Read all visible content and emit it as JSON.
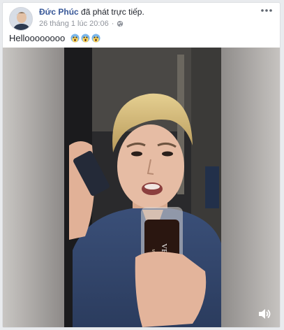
{
  "post": {
    "author": "Đức Phúc",
    "action": "đã phát trực tiếp.",
    "timestamp": "26 tháng 1 lúc 20:06",
    "privacy_icon": "globe-icon",
    "menu_icon": "more-options-icon",
    "caption": "Helloooooooo",
    "caption_emojis": [
      "scream-emoji",
      "scream-emoji",
      "scream-emoji"
    ]
  },
  "video": {
    "volume_icon": "volume-icon",
    "cup_text": "VEAIET",
    "cup_subtext": "MERIAGE"
  },
  "colors": {
    "link": "#385898",
    "meta": "#90949c",
    "background": "#e9ebee"
  }
}
